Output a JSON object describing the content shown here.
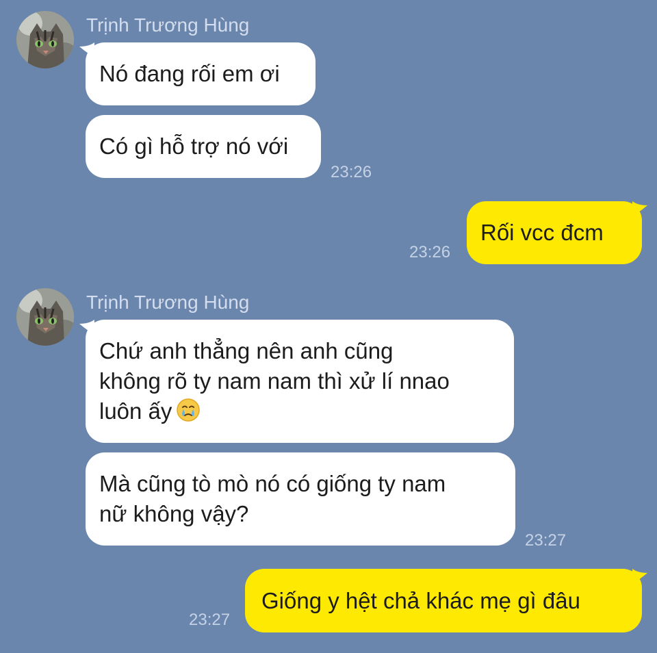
{
  "chat": {
    "contact": {
      "name": "Trịnh Trương Hùng",
      "avatar_icon": "cat-avatar-icon"
    },
    "colors": {
      "background": "#6b86ad",
      "incoming_bubble": "#ffffff",
      "outgoing_bubble": "#fde902",
      "timestamp": "#c5d2e6",
      "sender_name": "#d4dded"
    },
    "groups": [
      {
        "sender_name": "Trịnh Trương Hùng",
        "messages": [
          {
            "text": "Nó đang rối em ơi"
          },
          {
            "text": "Có gì hỗ trợ nó với",
            "time": "23:26"
          }
        ]
      },
      {
        "outgoing": true,
        "messages": [
          {
            "text": "Rối vcc đcm",
            "time": "23:26"
          }
        ]
      },
      {
        "sender_name": "Trịnh Trương Hùng",
        "messages": [
          {
            "text": "Chứ anh thẳng nên anh cũng\nkhông rõ ty nam nam thì xử lí nnao\nluôn ấy",
            "emoji": "face-holding-back-tears-icon"
          },
          {
            "text": "Mà cũng tò mò nó có giống ty nam\nnữ không vậy?",
            "time": "23:27"
          }
        ]
      },
      {
        "outgoing": true,
        "messages": [
          {
            "text": "Giống y hệt chả khác mẹ gì đâu",
            "time": "23:27"
          }
        ]
      }
    ]
  }
}
